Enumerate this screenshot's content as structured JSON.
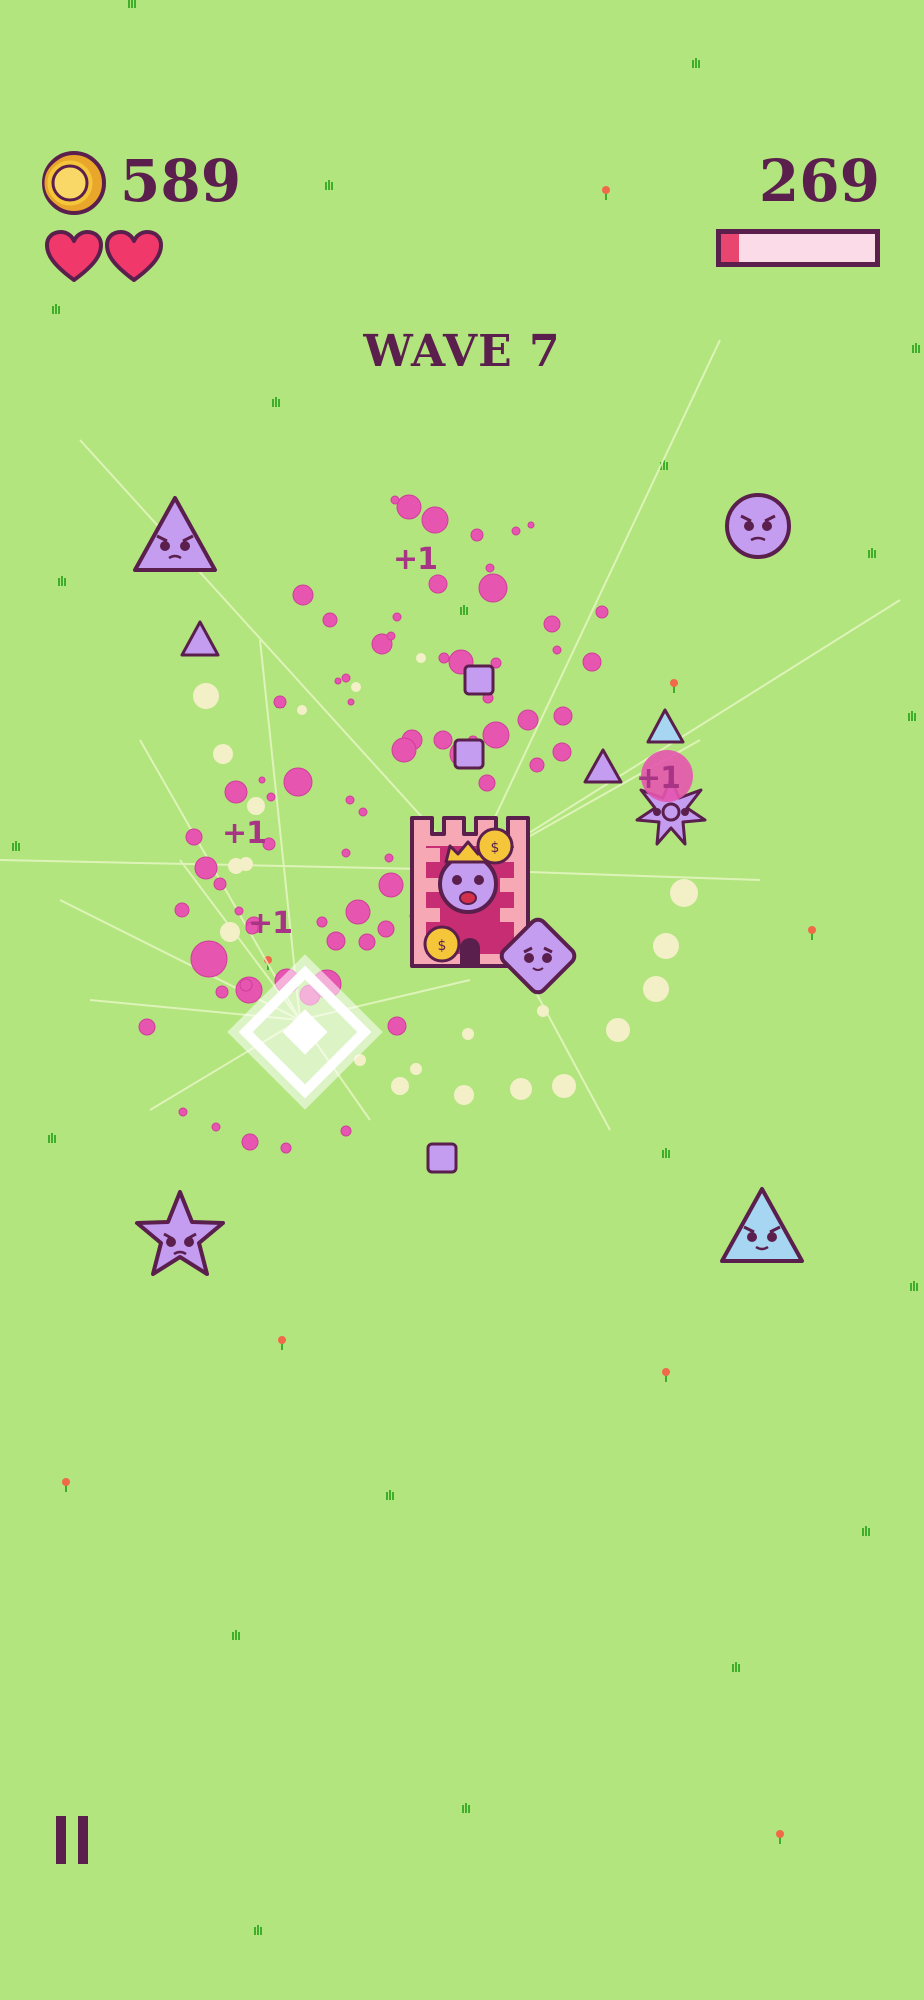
{
  "hud": {
    "coins": "589",
    "hearts": 2,
    "score": "269",
    "progress_fraction": 0.12,
    "wave_label": "WAVE 7"
  },
  "popups": {
    "plus_one": "+1"
  },
  "colors": {
    "background": "#b2e57e",
    "hud_text": "#5a1f4d",
    "heart": "#f0386b",
    "coin": "#f5c63a",
    "enemy_purple": "#c49df0",
    "enemy_blue": "#a6d6f2",
    "particle_pink": "#e655b0",
    "tower": "#f7a8b5"
  },
  "icons": {
    "coin": "coin-icon",
    "heart": "heart-icon",
    "pause": "pause-icon"
  }
}
